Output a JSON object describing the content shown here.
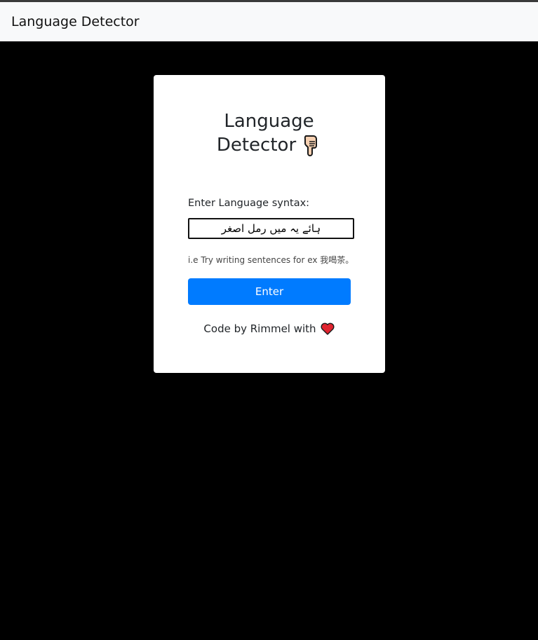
{
  "navbar": {
    "brand": "Language Detector"
  },
  "card": {
    "title_line1": "Language",
    "title_line2": "Detector",
    "title_icon": "pointing-down-hand-icon",
    "input_label": "Enter Language syntax:",
    "input_value": "ہائے یہ میں رمل اصغر",
    "hint": "i.e Try writing sentences for ex 我喝茶。",
    "enter_label": "Enter",
    "footer_text": "Code by Rimmel with",
    "footer_icon": "heart-icon"
  },
  "colors": {
    "page_background": "#000000",
    "navbar_background": "#f8f9fa",
    "card_background": "#ffffff",
    "button": "#007bff",
    "heart": "#e0242f"
  }
}
